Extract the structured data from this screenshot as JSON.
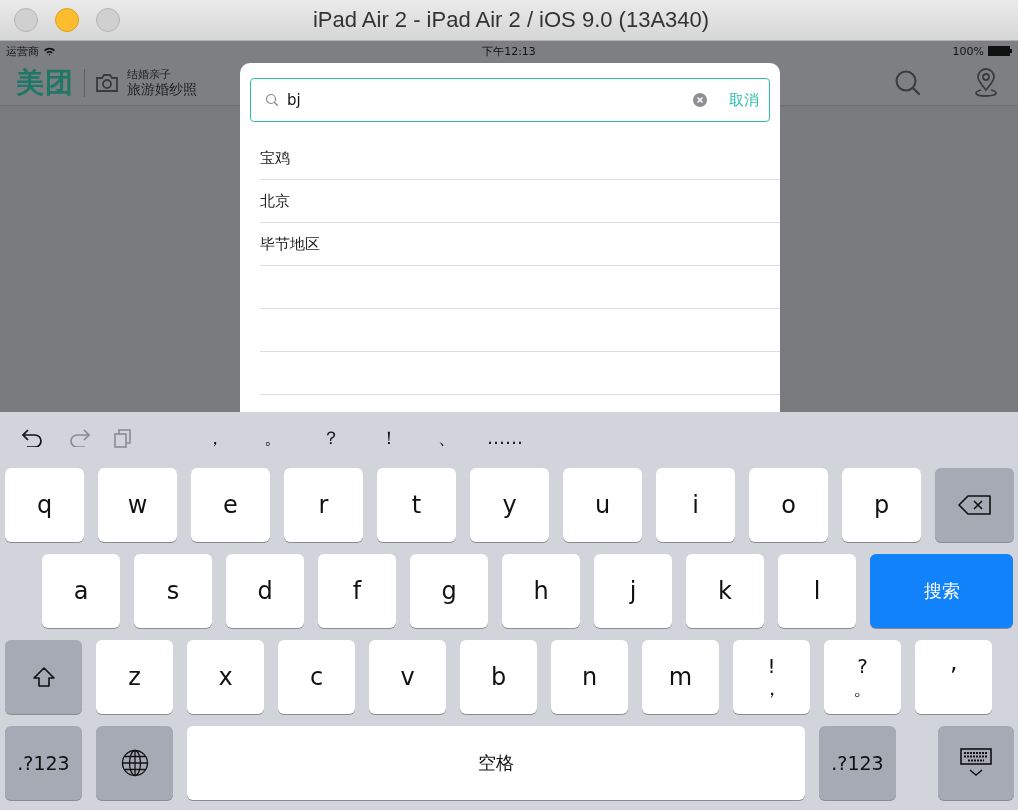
{
  "window": {
    "title": "iPad Air 2 - iPad Air 2 / iOS 9.0 (13A340)"
  },
  "status_bar": {
    "carrier": "运营商",
    "time": "下午12:13",
    "battery": "100%"
  },
  "header": {
    "logo": "美团",
    "category_line_1": "结婚亲子",
    "category_line_2": "旅游婚纱照"
  },
  "search": {
    "value": "bj",
    "cancel": "取消"
  },
  "results": [
    "宝鸡",
    "北京",
    "毕节地区"
  ],
  "keyboard": {
    "toolbar_icons": [
      {
        "kind": "undo",
        "disabled": false
      },
      {
        "kind": "redo",
        "disabled": true
      },
      {
        "kind": "paste",
        "disabled": true
      }
    ],
    "suggestions": [
      "，",
      "。",
      "？",
      "！",
      "、",
      "……"
    ],
    "rows": {
      "row_1": [
        {
          "kind": "letter",
          "label": "q"
        },
        {
          "kind": "letter",
          "label": "w"
        },
        {
          "kind": "letter",
          "label": "e"
        },
        {
          "kind": "letter",
          "label": "r"
        },
        {
          "kind": "letter",
          "label": "t"
        },
        {
          "kind": "letter",
          "label": "y"
        },
        {
          "kind": "letter",
          "label": "u"
        },
        {
          "kind": "letter",
          "label": "i"
        },
        {
          "kind": "letter",
          "label": "o"
        },
        {
          "kind": "letter",
          "label": "p"
        },
        {
          "kind": "backspace"
        }
      ],
      "row_2": [
        {
          "kind": "letter",
          "label": "a"
        },
        {
          "kind": "letter",
          "label": "s"
        },
        {
          "kind": "letter",
          "label": "d"
        },
        {
          "kind": "letter",
          "label": "f"
        },
        {
          "kind": "letter",
          "label": "g"
        },
        {
          "kind": "letter",
          "label": "h"
        },
        {
          "kind": "letter",
          "label": "j"
        },
        {
          "kind": "letter",
          "label": "k"
        },
        {
          "kind": "letter",
          "label": "l"
        },
        {
          "kind": "search",
          "label": "搜索"
        }
      ],
      "row_3": [
        {
          "kind": "shift"
        },
        {
          "kind": "letter",
          "label": "z"
        },
        {
          "kind": "letter",
          "label": "x"
        },
        {
          "kind": "letter",
          "label": "c"
        },
        {
          "kind": "letter",
          "label": "v"
        },
        {
          "kind": "letter",
          "label": "b"
        },
        {
          "kind": "letter",
          "label": "n"
        },
        {
          "kind": "letter",
          "label": "m"
        },
        {
          "kind": "dual",
          "label": "!",
          "label_2": "，"
        },
        {
          "kind": "dual",
          "label": "?",
          "label_2": "。"
        },
        {
          "kind": "letter",
          "label": "’"
        }
      ],
      "row_4": [
        {
          "kind": "mode",
          "label": ".?123"
        },
        {
          "kind": "globe"
        },
        {
          "kind": "space",
          "label": "空格"
        },
        {
          "kind": "mode",
          "label": ".?123"
        },
        {
          "kind": "dismiss"
        }
      ]
    }
  }
}
